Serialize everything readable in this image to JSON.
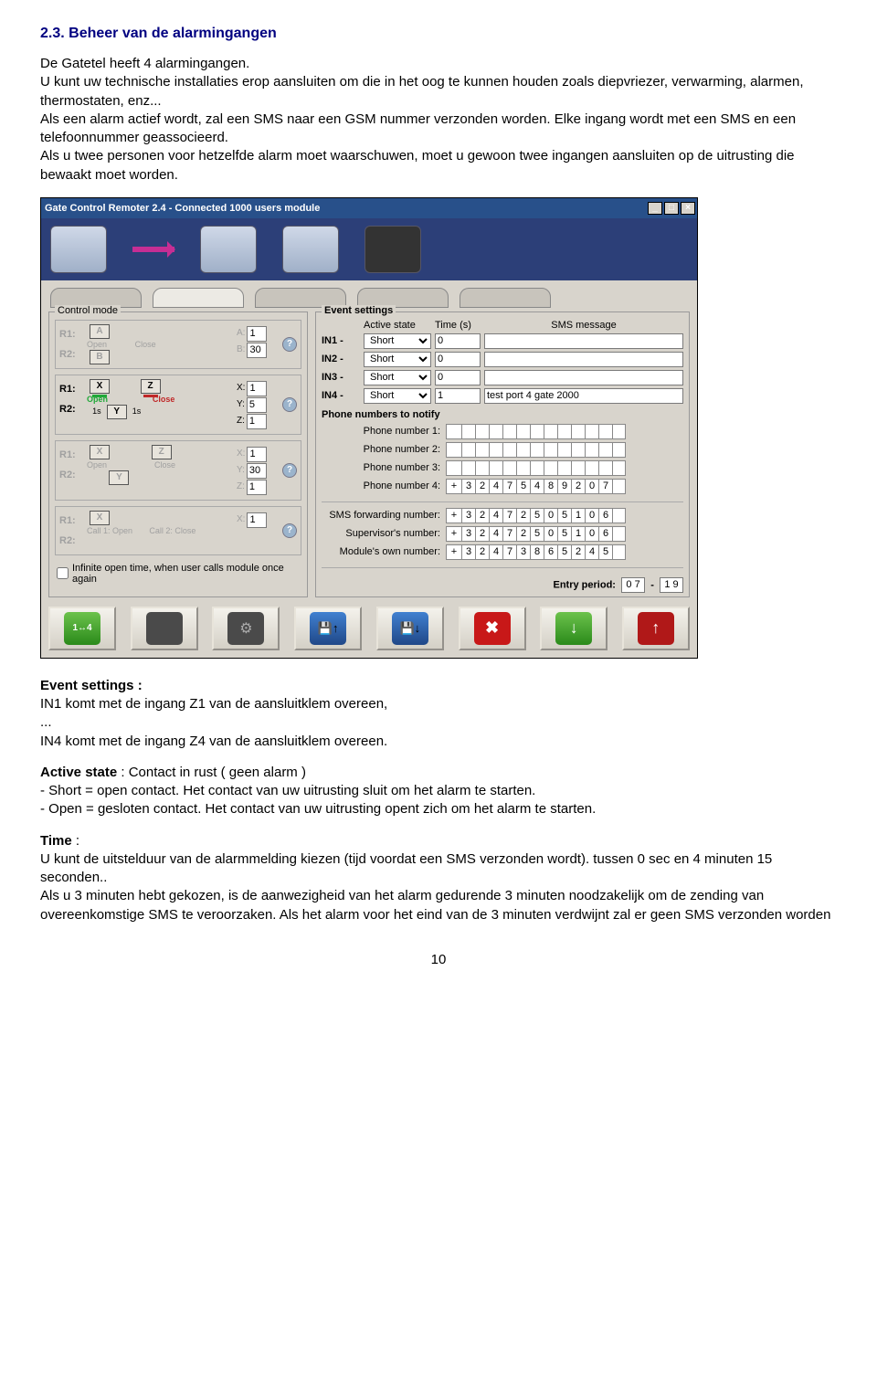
{
  "heading": "2.3. Beheer van de alarmingangen",
  "intro1": "De Gatetel heeft 4 alarmingangen.",
  "intro2": "U kunt uw technische installaties erop aansluiten om die in het oog te kunnen houden zoals diepvriezer, verwarming, alarmen, thermostaten, enz...",
  "intro3": "Als een alarm actief wordt, zal een SMS naar een GSM nummer verzonden worden. Elke ingang wordt met een SMS en een telefoonnummer geassocieerd.",
  "intro4": "Als u twee personen voor hetzelfde alarm moet waarschuwen, moet u gewoon twee ingangen aansluiten op de uitrusting die bewaakt moet worden.",
  "app": {
    "title": "Gate Control Remoter 2.4 - Connected 1000 users module",
    "control_label": "Control mode",
    "event_label": "Event settings",
    "infinite_label": "Infinite open time, when user calls module once again",
    "modes": [
      {
        "r1": "R1:",
        "r2": "R2:",
        "a": "A",
        "b": "B",
        "open": "Open",
        "close": "Close",
        "va": "A:",
        "vb": "B:",
        "vav": "1",
        "vbv": "30",
        "active": false
      },
      {
        "r1": "R1:",
        "r2": "R2:",
        "x": "X",
        "y": "Y",
        "z": "Z",
        "open": "Open",
        "close": "Close",
        "s1": "1s",
        "s2": "1s",
        "vx": "X:",
        "vy": "Y:",
        "vz": "Z:",
        "vxv": "1",
        "vyv": "5",
        "vzv": "1",
        "active": true
      },
      {
        "r1": "R1:",
        "r2": "R2:",
        "x": "X",
        "y": "Y",
        "z": "Z",
        "open": "Open",
        "close": "Close",
        "vx": "X:",
        "vy": "Y:",
        "vz": "Z:",
        "vxv": "1",
        "vyv": "30",
        "vzv": "1",
        "active": false
      },
      {
        "r1": "R1:",
        "r2": "R2:",
        "x": "X",
        "c1": "Call 1: Open",
        "c2": "Call 2: Close",
        "vx": "X:",
        "vxv": "1",
        "active": false
      }
    ],
    "ev_head_active": "Active state",
    "ev_head_time": "Time (s)",
    "ev_head_msg": "SMS message",
    "events": [
      {
        "label": "IN1 -",
        "state": "Short",
        "time": "0",
        "msg": ""
      },
      {
        "label": "IN2 -",
        "state": "Short",
        "time": "0",
        "msg": ""
      },
      {
        "label": "IN3 -",
        "state": "Short",
        "time": "0",
        "msg": ""
      },
      {
        "label": "IN4 -",
        "state": "Short",
        "time": "1",
        "msg": "test port 4 gate 2000"
      }
    ],
    "phones_title": "Phone numbers to notify",
    "phones": [
      {
        "label": "Phone number 1:",
        "digits": [
          "",
          "",
          "",
          "",
          "",
          "",
          "",
          "",
          "",
          "",
          "",
          "",
          ""
        ]
      },
      {
        "label": "Phone number 2:",
        "digits": [
          "",
          "",
          "",
          "",
          "",
          "",
          "",
          "",
          "",
          "",
          "",
          "",
          ""
        ]
      },
      {
        "label": "Phone number 3:",
        "digits": [
          "",
          "",
          "",
          "",
          "",
          "",
          "",
          "",
          "",
          "",
          "",
          "",
          ""
        ]
      },
      {
        "label": "Phone number 4:",
        "digits": [
          "+",
          "3",
          "2",
          "4",
          "7",
          "5",
          "4",
          "8",
          "9",
          "2",
          "0",
          "7",
          ""
        ]
      }
    ],
    "nums": [
      {
        "label": "SMS forwarding number:",
        "digits": [
          "+",
          "3",
          "2",
          "4",
          "7",
          "2",
          "5",
          "0",
          "5",
          "1",
          "0",
          "6",
          ""
        ]
      },
      {
        "label": "Supervisor's number:",
        "digits": [
          "+",
          "3",
          "2",
          "4",
          "7",
          "2",
          "5",
          "0",
          "5",
          "1",
          "0",
          "6",
          ""
        ]
      },
      {
        "label": "Module's own number:",
        "digits": [
          "+",
          "3",
          "2",
          "4",
          "7",
          "3",
          "8",
          "6",
          "5",
          "2",
          "4",
          "5",
          ""
        ]
      }
    ],
    "entry_label": "Entry period:",
    "entry_from": "0 7",
    "entry_to": "1 9",
    "entry_sep": "-"
  },
  "post1_label": "Event settings :",
  "post1a": "IN1 komt met de ingang Z1 van de aansluitklem overeen,",
  "post1b": "...",
  "post1c": "IN4 komt met de ingang Z4 van de aansluitklem overeen.",
  "post2_label": "Active state",
  "post2a": " : Contact in rust ( geen alarm )",
  "post2b": "- Short = open contact.   Het contact van uw uitrusting sluit om het alarm te starten.",
  "post2c": "- Open = gesloten contact.  Het contact van uw uitrusting opent zich om het alarm te starten.",
  "post3_label": "Time",
  "post3a": " :",
  "post3b": "U kunt de uitstelduur van de alarmmelding kiezen (tijd voordat een SMS verzonden wordt). tussen 0 sec en 4 minuten 15 seconden..",
  "post3c": "Als u 3 minuten hebt gekozen, is de aanwezigheid van het alarm gedurende 3 minuten noodzakelijk om de zending van overeenkomstige SMS te veroorzaken. Als het alarm voor het eind van de 3 minuten verdwijnt zal er geen SMS verzonden worden",
  "pagenum": "10"
}
